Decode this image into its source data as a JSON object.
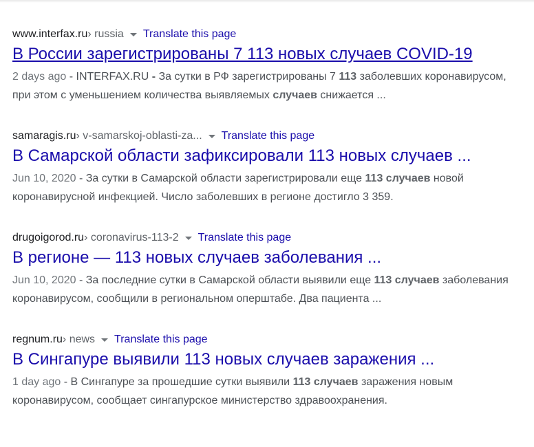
{
  "results": [
    {
      "domain": "www.interfax.ru",
      "path": " › russia",
      "translate_label": "Translate this page",
      "title": "В России зарегистрированы 7 113 новых случаев COVID-19",
      "date": "2 days ago",
      "snippet_parts": [
        {
          "text": " - INTERFAX.RU ",
          "bold": false
        },
        {
          "text": "-",
          "bold": true
        },
        {
          "text": " За сутки в РФ зарегистрированы 7 ",
          "bold": false
        },
        {
          "text": "113",
          "bold": true
        },
        {
          "text": " заболевших коронавирусом, при этом с уменьшением количества выявляемых ",
          "bold": false
        },
        {
          "text": "случаев",
          "bold": true
        },
        {
          "text": " снижается ...",
          "bold": false
        }
      ]
    },
    {
      "domain": "samaragis.ru",
      "path": " › v-samarskoj-oblasti-za...",
      "translate_label": "Translate this page",
      "title": "В Самарской области зафиксировали 113 новых случаев ...",
      "date": "Jun 10, 2020",
      "snippet_parts": [
        {
          "text": " - За сутки в Самарской области зарегистрировали еще ",
          "bold": false
        },
        {
          "text": "113 случаев",
          "bold": true
        },
        {
          "text": " новой коронавирусной инфекцией. Число заболевших в регионе достигло 3 359.",
          "bold": false
        }
      ]
    },
    {
      "domain": "drugoigorod.ru",
      "path": " › coronavirus-113-2",
      "translate_label": "Translate this page",
      "title": "В регионе — 113 новых случаев заболевания ...",
      "date": "Jun 10, 2020",
      "snippet_parts": [
        {
          "text": " - За последние сутки в Самарской области выявили еще ",
          "bold": false
        },
        {
          "text": "113 случаев",
          "bold": true
        },
        {
          "text": " заболевания коронавирусом, сообщили в региональном оперштабе. Два пациента ...",
          "bold": false
        }
      ]
    },
    {
      "domain": "regnum.ru",
      "path": " › news",
      "translate_label": "Translate this page",
      "title": "В Сингапуре выявили 113 новых случаев заражения ...",
      "date": "1 day ago",
      "snippet_parts": [
        {
          "text": " - В Сингапуре за прошедшие сутки выявили ",
          "bold": false
        },
        {
          "text": "113 случаев",
          "bold": true
        },
        {
          "text": " заражения новым коронавирусом, сообщает сингапурское министерство здравоохранения.",
          "bold": false
        }
      ]
    }
  ],
  "colors": {
    "link": "#1a0dab",
    "snippet": "#4d5156",
    "cite": "#202124",
    "date": "#70757a"
  }
}
